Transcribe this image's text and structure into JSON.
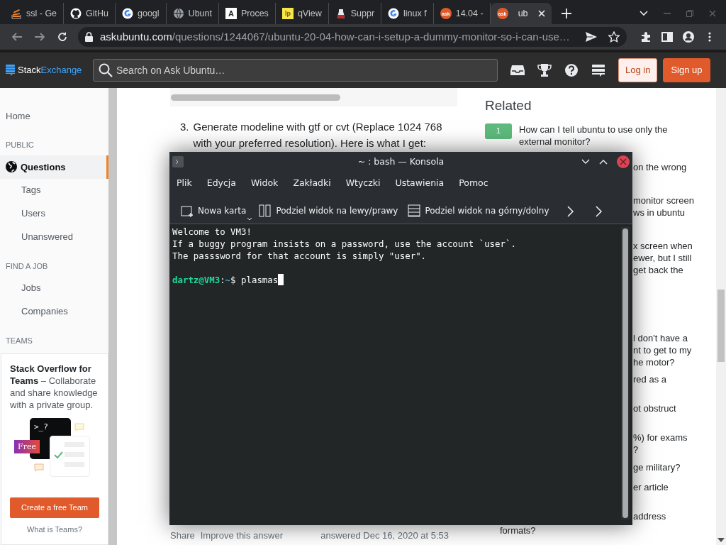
{
  "browser": {
    "tabs": [
      {
        "title": "ssl - Ge",
        "kind": "stack",
        "selected": false
      },
      {
        "title": "GitHu",
        "kind": "github",
        "selected": false
      },
      {
        "title": "googl",
        "kind": "google",
        "selected": false
      },
      {
        "title": "Ubunt",
        "kind": "globe",
        "selected": false
      },
      {
        "title": "Proces",
        "kind": "letter",
        "favicon_label": "A",
        "selected": false
      },
      {
        "title": "qView",
        "kind": "letter2",
        "favicon_label": "lp",
        "selected": false
      },
      {
        "title": "Suppr",
        "kind": "drop",
        "selected": false
      },
      {
        "title": "linux f",
        "kind": "google",
        "selected": false
      },
      {
        "title": "14.04 -",
        "kind": "ask",
        "favicon_label": "ask",
        "selected": false
      },
      {
        "title": "ub",
        "kind": "ask",
        "favicon_label": "ask",
        "selected": true
      }
    ],
    "url": {
      "host": "askubuntu.com",
      "path": "/questions/1244067/ubuntu-20-04-how-can-i-setup-a-dummy-monitor-so-i-can-use…"
    }
  },
  "header": {
    "logo_first": "Stack",
    "logo_second": "Exchange",
    "search_placeholder": "Search on Ask Ubuntu…",
    "login": "Log in",
    "signup": "Sign up"
  },
  "sidebar": {
    "items": [
      {
        "label": "Home",
        "kind": "link",
        "selected": false
      },
      {
        "label": "PUBLIC",
        "kind": "heading"
      },
      {
        "label": "Questions",
        "kind": "main",
        "selected": true
      },
      {
        "label": "Tags",
        "kind": "sub",
        "selected": false
      },
      {
        "label": "Users",
        "kind": "sub",
        "selected": false
      },
      {
        "label": "Unanswered",
        "kind": "sub",
        "selected": false
      },
      {
        "label": "FIND A JOB",
        "kind": "heading"
      },
      {
        "label": "Jobs",
        "kind": "sub",
        "selected": false
      },
      {
        "label": "Companies",
        "kind": "sub",
        "selected": false
      },
      {
        "label": "TEAMS",
        "kind": "heading"
      }
    ],
    "teams": {
      "text": "**Stack Overflow for Teams** – Collaborate and share knowledge with a private group.",
      "prompt": ">_?",
      "badge": "Free",
      "button": "Create a free Team",
      "link": "What is Teams?"
    }
  },
  "answer": {
    "step_number": "3.",
    "step_text": "Generate modeline with gtf or cvt (Replace 1024 768 with your preferred resolution). Here is what I get:",
    "share": "Share",
    "improve": "Improve this answer",
    "answered": "answered Dec 16, 2020 at 5:53"
  },
  "related": {
    "title": "Related",
    "first": {
      "score": "1",
      "text": "How can I tell ubuntu to use only the external monitor?"
    },
    "fragments": [
      [
        "on the wrong"
      ],
      [
        "monitor screen",
        "ws in ubuntu"
      ],
      [
        "x screen when",
        "ewer, but I still",
        "get back the"
      ],
      [
        "l don't have a",
        "nt to get to my",
        "he motor?"
      ],
      [
        "red as a"
      ],
      [
        "ot obstruct"
      ],
      [
        "%) for exams",
        "?"
      ],
      [
        "ge military?"
      ],
      [
        "er article"
      ],
      [
        "address"
      ]
    ],
    "tail": "formats?"
  },
  "konsole": {
    "title": "~ : bash — Konsola",
    "menu": [
      "Plik",
      "Edycja",
      "Widok",
      "Zakładki",
      "Wtyczki",
      "Ustawienia",
      "Pomoc"
    ],
    "toolbar": [
      {
        "label": "Nowa karta",
        "kind": "newtab",
        "dropdown": true
      },
      {
        "label": "Podziel widok na lewy/prawy",
        "kind": "splitv",
        "dropdown": false
      },
      {
        "label": "Podziel widok na górny/dolny",
        "kind": "splith",
        "dropdown": false
      }
    ],
    "lines": [
      "Welcome to VM3!",
      "If a buggy program insists on a password, use the account `user`.",
      "The passsword for that account is simply \"user\"."
    ],
    "prompt": {
      "user": "dartz@VM3",
      "sep": ":",
      "path": "~",
      "symbol": "$",
      "command": "plasmas"
    }
  }
}
